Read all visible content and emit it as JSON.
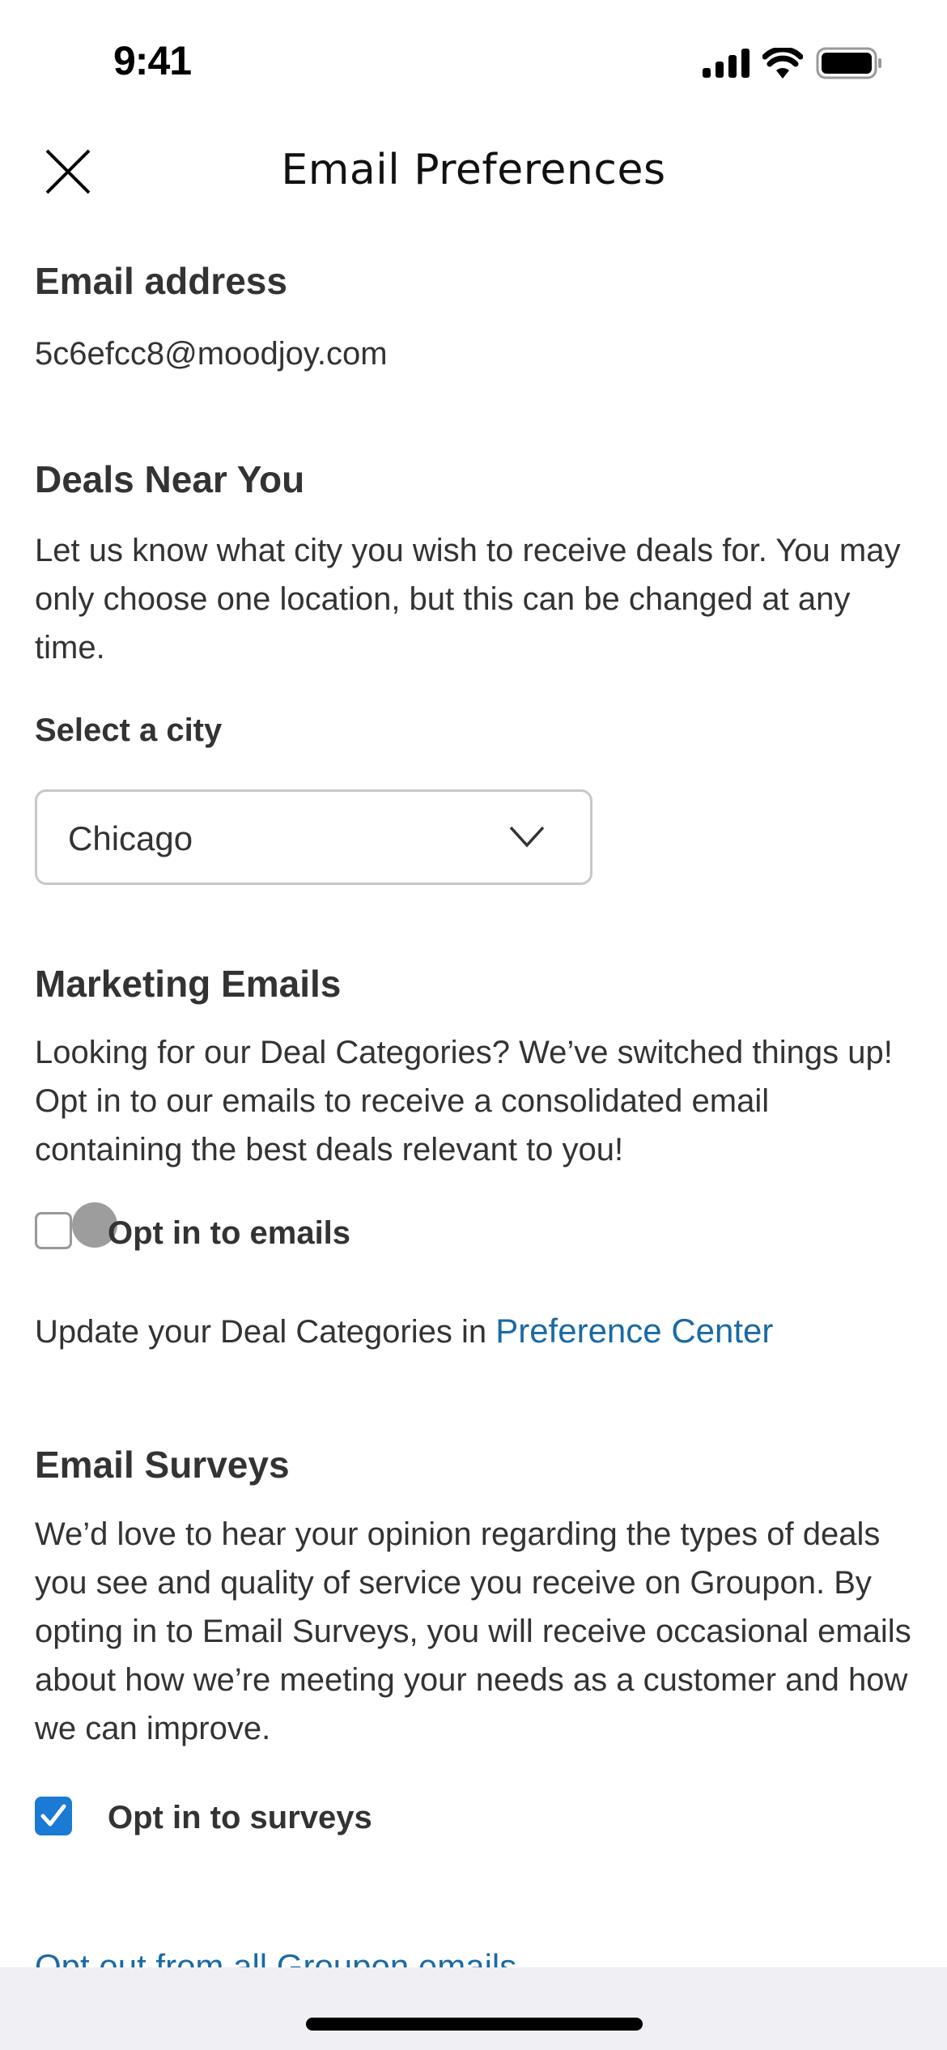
{
  "status_bar": {
    "time": "9:41",
    "icons": [
      "cellular-signal-icon",
      "wifi-icon",
      "battery-icon"
    ]
  },
  "nav": {
    "title": "Email Preferences",
    "close_icon": "close-icon"
  },
  "email_section": {
    "heading": "Email address",
    "value": "5c6efcc8@moodjoy.com"
  },
  "deals_section": {
    "heading": "Deals Near You",
    "description": "Let us know what city you wish to receive deals for. You may only choose one location, but this can be changed at any time.",
    "select_label": "Select a city",
    "selected_city": "Chicago"
  },
  "marketing_section": {
    "heading": "Marketing Emails",
    "description": "Looking for our Deal Categories? We’ve switched things up! Opt in to our emails to receive a consolidated email containing the best deals relevant to you!",
    "checkbox_label": "Opt in to emails",
    "checked": false,
    "pref_text": "Update your Deal Categories in ",
    "pref_link": "Preference Center"
  },
  "surveys_section": {
    "heading": "Email Surveys",
    "description": "We’d love to hear your opinion regarding the types of deals you see and quality of service you receive on Groupon. By opting in to Email Surveys, you will receive occasional emails about how we’re meeting your needs as a customer and how we can improve.",
    "checkbox_label": "Opt in to surveys",
    "checked": true
  },
  "footer": {
    "opt_out_link": "Opt out from all Groupon emails"
  },
  "colors": {
    "link": "#1b6aa5",
    "checkbox_checked": "#1a7ad4",
    "text": "#333333"
  }
}
